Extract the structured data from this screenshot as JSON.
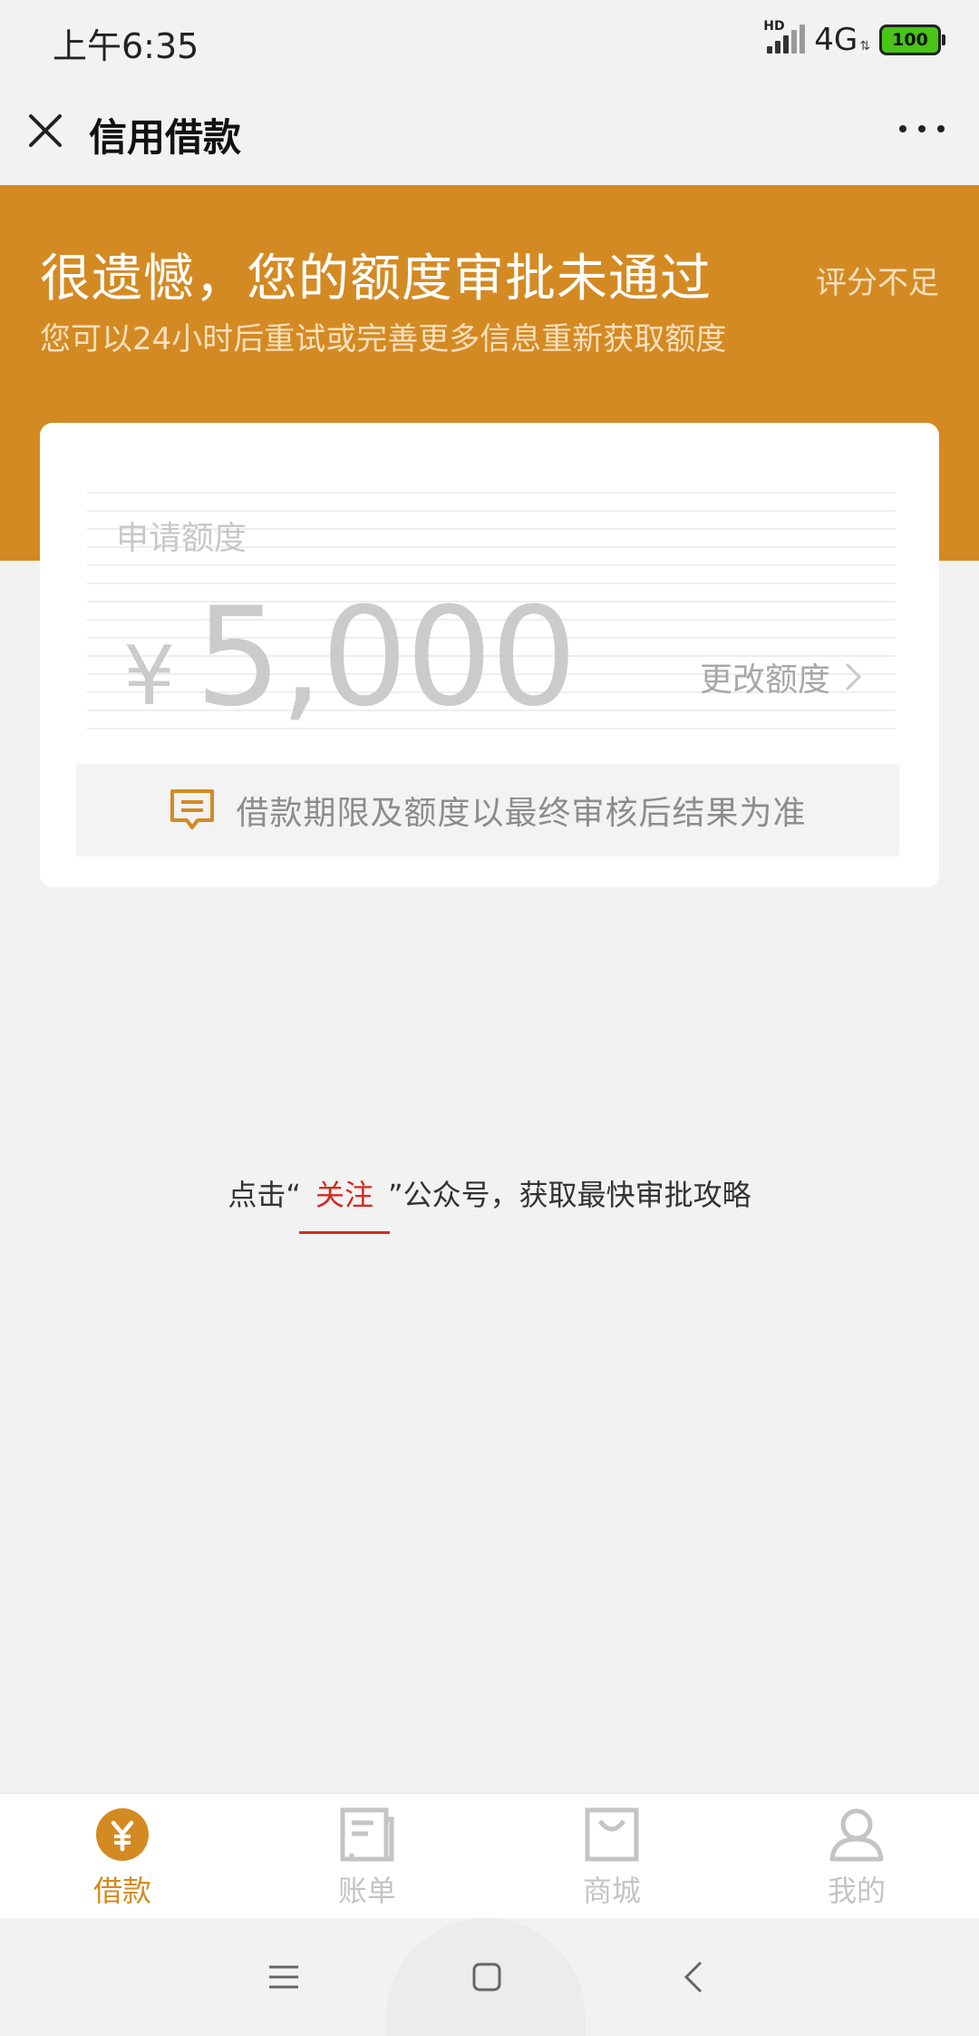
{
  "status_bar": {
    "time": "上午6:35",
    "signal_label": "HD",
    "network": "4G",
    "battery": "100"
  },
  "nav": {
    "title": "信用借款"
  },
  "hero": {
    "title": "很遗憾，您的额度审批未通过",
    "score_label": "评分不足",
    "subtitle": "您可以24小时后重试或完善更多信息重新获取额度"
  },
  "card": {
    "apply_label": "申请额度",
    "currency": "¥",
    "amount": "5,000",
    "change_label": "更改额度",
    "notice": "借款期限及额度以最终审核后结果为准"
  },
  "follow_tip": {
    "prefix": "点击“",
    "highlight": "关注",
    "suffix": "”公众号，获取最快审批攻略"
  },
  "tabs": [
    {
      "label": "借款",
      "icon": "yen-icon",
      "active": true
    },
    {
      "label": "账单",
      "icon": "bill-icon",
      "active": false
    },
    {
      "label": "商城",
      "icon": "shop-bag-icon",
      "active": false
    },
    {
      "label": "我的",
      "icon": "user-icon",
      "active": false
    }
  ],
  "colors": {
    "accent": "#d48a23",
    "highlight_red": "#d42a1e"
  }
}
